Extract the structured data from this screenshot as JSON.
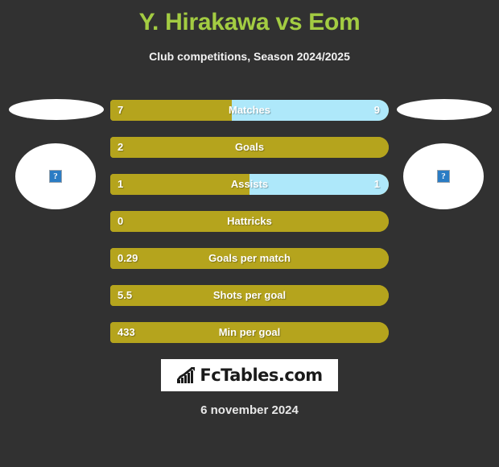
{
  "header": {
    "title": "Y. Hirakawa vs Eom",
    "subtitle": "Club competitions, Season 2024/2025",
    "title_color": "#a3cc42"
  },
  "colors": {
    "background": "#313131",
    "home_bar": "#b5a41d",
    "away_bar": "#aee8fa",
    "title_green": "#a3cc42",
    "text_white": "#ffffff"
  },
  "players": {
    "home": {
      "name": "Y. Hirakawa",
      "avatar_icon": "broken-image-icon",
      "avatar_placeholder": "?"
    },
    "away": {
      "name": "Eom",
      "avatar_icon": "broken-image-icon",
      "avatar_placeholder": "?"
    }
  },
  "chart_data": {
    "type": "bar",
    "title": "Y. Hirakawa vs Eom",
    "subtitle": "Club competitions, Season 2024/2025",
    "orientation": "horizontal-diverging",
    "series": [
      {
        "name": "Y. Hirakawa",
        "color": "#b5a41d"
      },
      {
        "name": "Eom",
        "color": "#aee8fa"
      }
    ],
    "categories": [
      "Matches",
      "Goals",
      "Assists",
      "Hattricks",
      "Goals per match",
      "Shots per goal",
      "Min per goal"
    ],
    "rows": [
      {
        "label": "Matches",
        "home": "7",
        "away": "9",
        "home_pct": 43.7,
        "away_pct": 56.3
      },
      {
        "label": "Goals",
        "home": "2",
        "away": "",
        "home_pct": 100,
        "away_pct": 0
      },
      {
        "label": "Assists",
        "home": "1",
        "away": "1",
        "home_pct": 50,
        "away_pct": 50
      },
      {
        "label": "Hattricks",
        "home": "0",
        "away": "",
        "home_pct": 100,
        "away_pct": 0
      },
      {
        "label": "Goals per match",
        "home": "0.29",
        "away": "",
        "home_pct": 100,
        "away_pct": 0
      },
      {
        "label": "Shots per goal",
        "home": "5.5",
        "away": "",
        "home_pct": 100,
        "away_pct": 0
      },
      {
        "label": "Min per goal",
        "home": "433",
        "away": "",
        "home_pct": 100,
        "away_pct": 0
      }
    ]
  },
  "footer": {
    "logo_text": "FcTables.com",
    "logo_icon": "bar-chart-trend-icon",
    "date": "6 november 2024"
  }
}
